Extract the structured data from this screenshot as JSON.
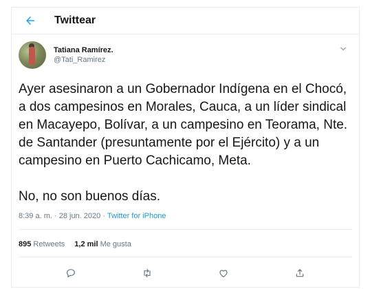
{
  "header": {
    "title": "Twittear"
  },
  "author": {
    "display_name": "Tatiana Ramírez.",
    "handle": "@Tati_Ramirez"
  },
  "tweet": {
    "text": "Ayer asesinaron a un Gobernador Indígena en el Chocó,\na dos campesinos en Morales, Cauca, a un líder sindical\nen Macayepo, Bolívar, a un campesino en Teorama, Nte.\nde Santander (presuntamente por el Ejército) y a un\ncampesino en Puerto Cachicamo, Meta.\n\nNo, no son buenos días.",
    "time": "8:39 a. m.",
    "sep1": " · ",
    "date": "28 jun. 2020",
    "sep2": " · ",
    "source": "Twitter for iPhone"
  },
  "stats": {
    "retweets_count": "895",
    "retweets_label": "Retweets",
    "likes_count": "1,2 mil",
    "likes_label": "Me gusta"
  },
  "icons": [
    "back-arrow-icon",
    "chevron-down-icon",
    "reply-icon",
    "retweet-icon",
    "like-icon",
    "share-icon"
  ],
  "colors": {
    "accent": "#1da1f2",
    "secondary_text": "#657786",
    "icon_gray": "#657786"
  }
}
